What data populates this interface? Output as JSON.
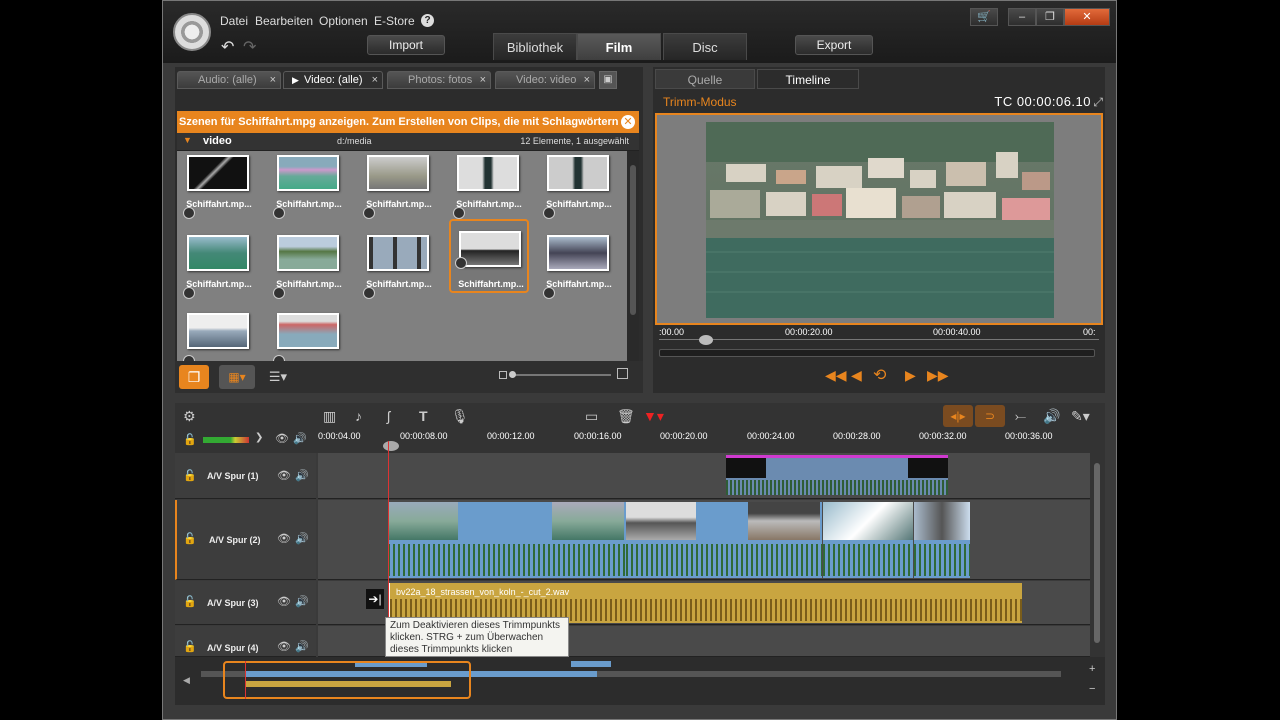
{
  "menu": [
    "Datei",
    "Bearbeiten",
    "Optionen",
    "E-Store",
    "?"
  ],
  "top_buttons": {
    "import": "Import",
    "export": "Export"
  },
  "main_tabs": [
    "Bibliothek",
    "Film",
    "Disc"
  ],
  "library": {
    "tabs": [
      {
        "label": "Audio: (alle)"
      },
      {
        "label": "Video: (alle)"
      },
      {
        "label": "Photos: fotos"
      },
      {
        "label": "Video: video"
      }
    ],
    "notice": "Szenen für Schiffahrt.mpg anzeigen. Zum Erstellen von Clips, die mit Schlagwörtern",
    "folder": "video",
    "path": "d:/media",
    "count": "12 Elemente, 1 ausgewählt",
    "thumbs": [
      "Schiffahrt.mp...",
      "Schiffahrt.mp...",
      "Schiffahrt.mp...",
      "Schiffahrt.mp...",
      "Schiffahrt.mp...",
      "Schiffahrt.mp...",
      "Schiffahrt.mp...",
      "Schiffahrt.mp...",
      "Schiffahrt.mp...",
      "Schiffahrt.mp..."
    ]
  },
  "player": {
    "tabs": [
      "Quelle",
      "Timeline"
    ],
    "mode": "Trimm-Modus",
    "timecode": "TC 00:00:06.10",
    "ruler": [
      ":00.00",
      "00:00:20.00",
      "00:00:40.00",
      "00:"
    ]
  },
  "timeline": {
    "ruler": [
      "0:00:04.00",
      "00:00:08.00",
      "00:00:12.00",
      "00:00:16.00",
      "00:00:20.00",
      "00:00:24.00",
      "00:00:28.00",
      "00:00:32.00",
      "00:00:36.00"
    ],
    "tracks": [
      "A/V Spur (1)",
      "A/V Spur (2)",
      "A/V Spur (3)",
      "A/V Spur (4)"
    ],
    "audio_clip": "bv22a_18_strassen_von_koln_-_cut_2.wav",
    "tooltip": "Zum Deaktivieren dieses Trimmpunkts klicken. STRG + zum Überwachen dieses Trimmpunkts klicken"
  }
}
